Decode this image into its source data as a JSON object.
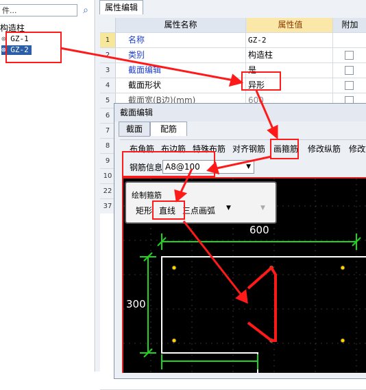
{
  "left": {
    "search_placeholder": "件...",
    "search_icon": "magnifier",
    "tree_root": "构造柱",
    "tree_items": [
      "GZ-1",
      "GZ-2"
    ]
  },
  "panel": {
    "tab": "属性编辑",
    "headers": {
      "name": "属性名称",
      "value": "属性值",
      "extra": "附加"
    },
    "rows": [
      {
        "no": "1",
        "name": "名称",
        "value": "GZ-2"
      },
      {
        "no": "2",
        "name": "类别",
        "value": "构造柱"
      },
      {
        "no": "3",
        "name": "截面编辑",
        "value": "是"
      },
      {
        "no": "4",
        "name": "截面形状",
        "value": "异形"
      },
      {
        "no": "5",
        "name": "截面宽(B边)(mm)",
        "value": "600"
      },
      {
        "no": "6",
        "name": "",
        "value": ""
      },
      {
        "no": "7",
        "name": "",
        "value": ""
      },
      {
        "no": "8",
        "name": "",
        "value": ""
      },
      {
        "no": "9",
        "name": "",
        "value": ""
      },
      {
        "no": "10",
        "name": "",
        "value": ""
      },
      {
        "no": "22",
        "name": "",
        "value": ""
      },
      {
        "no": "37",
        "name": "",
        "value": ""
      }
    ]
  },
  "dialog": {
    "title": "截面编辑",
    "tabs": [
      "截面",
      "配筋"
    ],
    "toolbar": [
      "布角筋",
      "布边筋",
      "特殊布筋",
      "对齐钢筋",
      "画箍筋",
      "修改纵筋",
      "修改筋"
    ],
    "rebar_label": "钢筋信息",
    "rebar_value": "A8@100",
    "draw_panel_title": "绘制箍筋",
    "draw_tools": [
      "矩形",
      "直线",
      "三点画弧"
    ],
    "dim_width": "600",
    "dim_height": "300"
  },
  "colors": {
    "annotation": "#ff1a1a",
    "dim": "#1fd41f",
    "selection": "#2c5ea8"
  }
}
